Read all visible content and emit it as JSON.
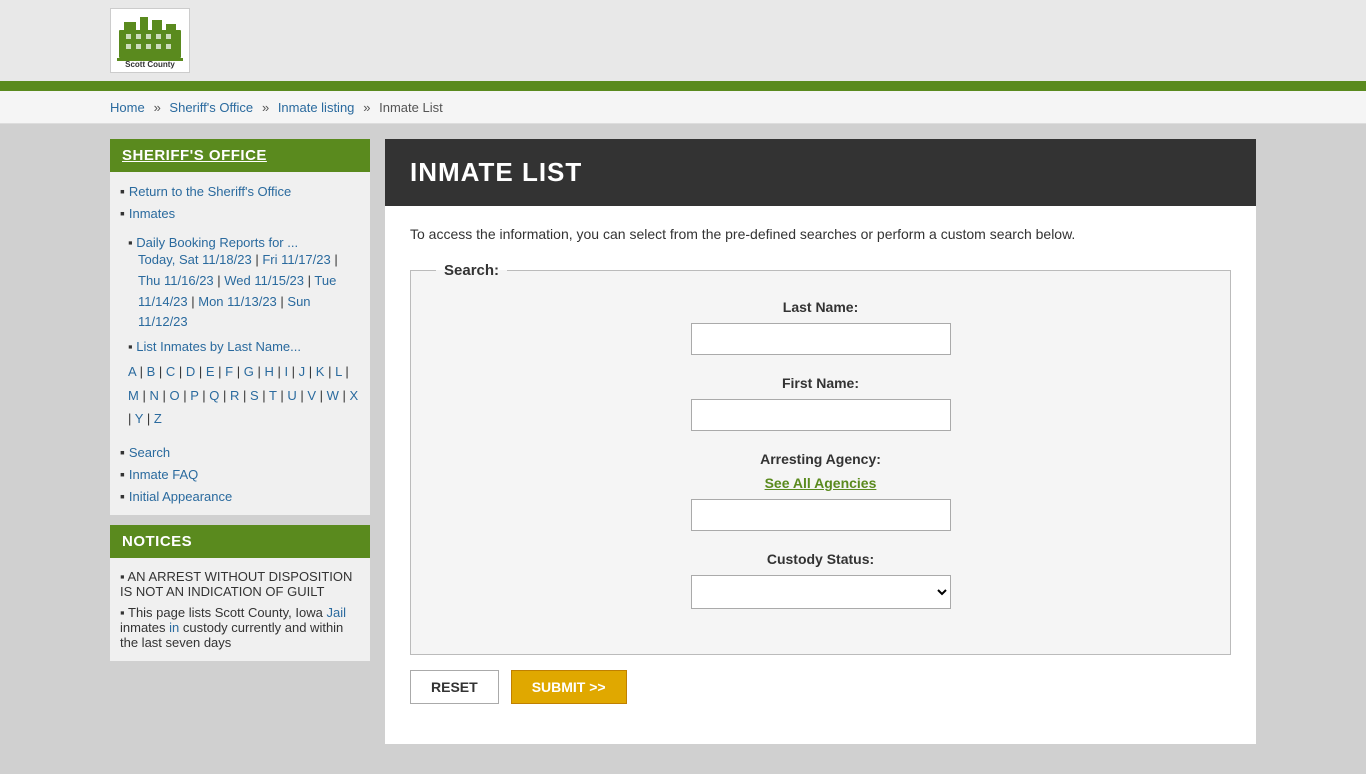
{
  "header": {
    "logo_alt": "Scott County",
    "county_name": "Scott County"
  },
  "breadcrumb": {
    "home": "Home",
    "sheriffs_office": "Sheriff's Office",
    "inmate_listing": "Inmate listing",
    "current": "Inmate List"
  },
  "sidebar": {
    "section1_title": "Sheriff's Office",
    "links": [
      {
        "id": "return-sheriff",
        "label": "Return to the Sheriff's Office"
      },
      {
        "id": "inmates",
        "label": "Inmates"
      }
    ],
    "daily_booking_label": "Daily Booking Reports for ...",
    "daily_dates": [
      {
        "label": "Today, Sat 11/18/23",
        "id": "today"
      },
      {
        "label": "Fri 11/17/23",
        "id": "fri"
      },
      {
        "label": "Thu 11/16/23",
        "id": "thu"
      },
      {
        "label": "Wed 11/15/23",
        "id": "wed"
      },
      {
        "label": "Tue 11/14/23",
        "id": "tue"
      },
      {
        "label": "Mon 11/13/23",
        "id": "mon"
      },
      {
        "label": "Sun 11/12/23",
        "id": "sun"
      }
    ],
    "list_by_lastname": "List Inmates by Last Name...",
    "alphabet": [
      "A",
      "B",
      "C",
      "D",
      "E",
      "F",
      "G",
      "H",
      "I",
      "J",
      "K",
      "L",
      "M",
      "N",
      "O",
      "P",
      "Q",
      "R",
      "S",
      "T",
      "U",
      "V",
      "W",
      "X",
      "Y",
      "Z"
    ],
    "search_label": "Search",
    "faq_label": "Inmate FAQ",
    "initial_appearance_label": "Initial Appearance",
    "section2_title": "Notices",
    "notice1": "AN ARREST WITHOUT DISPOSITION IS NOT AN INDICATION OF GUILT",
    "notice2_part1": "This page lists Scott County, Iowa ",
    "notice2_jail": "Jail",
    "notice2_part2": " inmates ",
    "notice2_in": "in",
    "notice2_part3": " custody currently and within the last seven days"
  },
  "main": {
    "page_title": "Inmate List",
    "intro_text": "To access the information, you can select from the pre-defined searches or perform a custom search below.",
    "search_legend": "Search:",
    "last_name_label": "Last Name:",
    "first_name_label": "First Name:",
    "arresting_agency_label": "Arresting Agency:",
    "see_all_agencies_label": "See All Agencies",
    "custody_status_label": "Custody Status:",
    "reset_label": "RESET",
    "submit_label": "SUBMIT >>"
  }
}
